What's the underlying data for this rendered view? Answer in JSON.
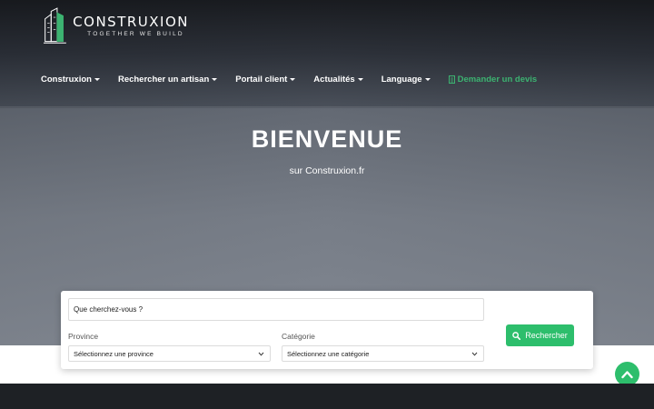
{
  "brand": {
    "name": "CONSTRUXION",
    "tagline": "Together we build",
    "accent": "#2dbe6c"
  },
  "nav": {
    "items": [
      {
        "label": "Construxion",
        "has_dropdown": true
      },
      {
        "label": "Rechercher un artisan",
        "has_dropdown": true
      },
      {
        "label": "Portail client",
        "has_dropdown": true
      },
      {
        "label": "Actualités",
        "has_dropdown": true
      },
      {
        "label": "Language",
        "has_dropdown": true
      }
    ],
    "cta": {
      "label": "Demander un devis",
      "icon": "document-icon"
    }
  },
  "hero": {
    "title": "BIENVENUE",
    "subtitle": "sur Construxion.fr"
  },
  "search": {
    "query_placeholder": "Que cherchez-vous ?",
    "province_label": "Province",
    "province_selected": "Sélectionnez une province",
    "category_label": "Catégorie",
    "category_selected": "Sélectionnez une catégorie",
    "button_label": "Rechercher",
    "button_icon": "search-icon"
  },
  "scroll_top": {
    "icon": "chevron-up-icon"
  }
}
